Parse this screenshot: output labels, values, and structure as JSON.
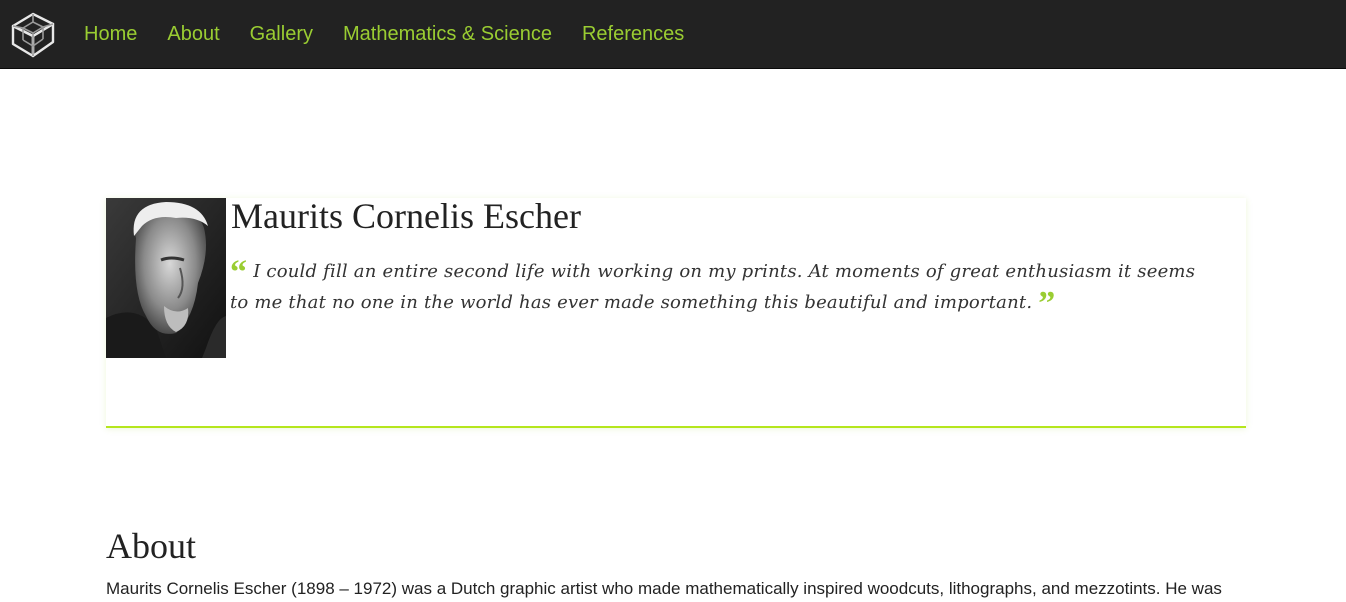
{
  "nav": {
    "logo_icon": "wireframe-cube-icon",
    "items": [
      {
        "label": "Home"
      },
      {
        "label": "About"
      },
      {
        "label": "Gallery"
      },
      {
        "label": "Mathematics & Science"
      },
      {
        "label": "References"
      }
    ]
  },
  "hero": {
    "title": "Maurits Cornelis Escher",
    "quote_open_icon": "quote-open-icon",
    "quote": "I could fill an entire second life with working on my prints. At moments of great enthusiasm it seems to me that no one in the world has ever made something this beautiful and important.",
    "quote_close_icon": "quote-close-icon"
  },
  "about": {
    "heading": "About",
    "text": "Maurits Cornelis Escher (1898 – 1972) was a Dutch graphic artist who made mathematically inspired woodcuts, lithographs, and mezzotints. He was"
  },
  "colors": {
    "accent": "#9acd32",
    "navbar_bg": "#222222",
    "divider": "#b5e61d"
  }
}
